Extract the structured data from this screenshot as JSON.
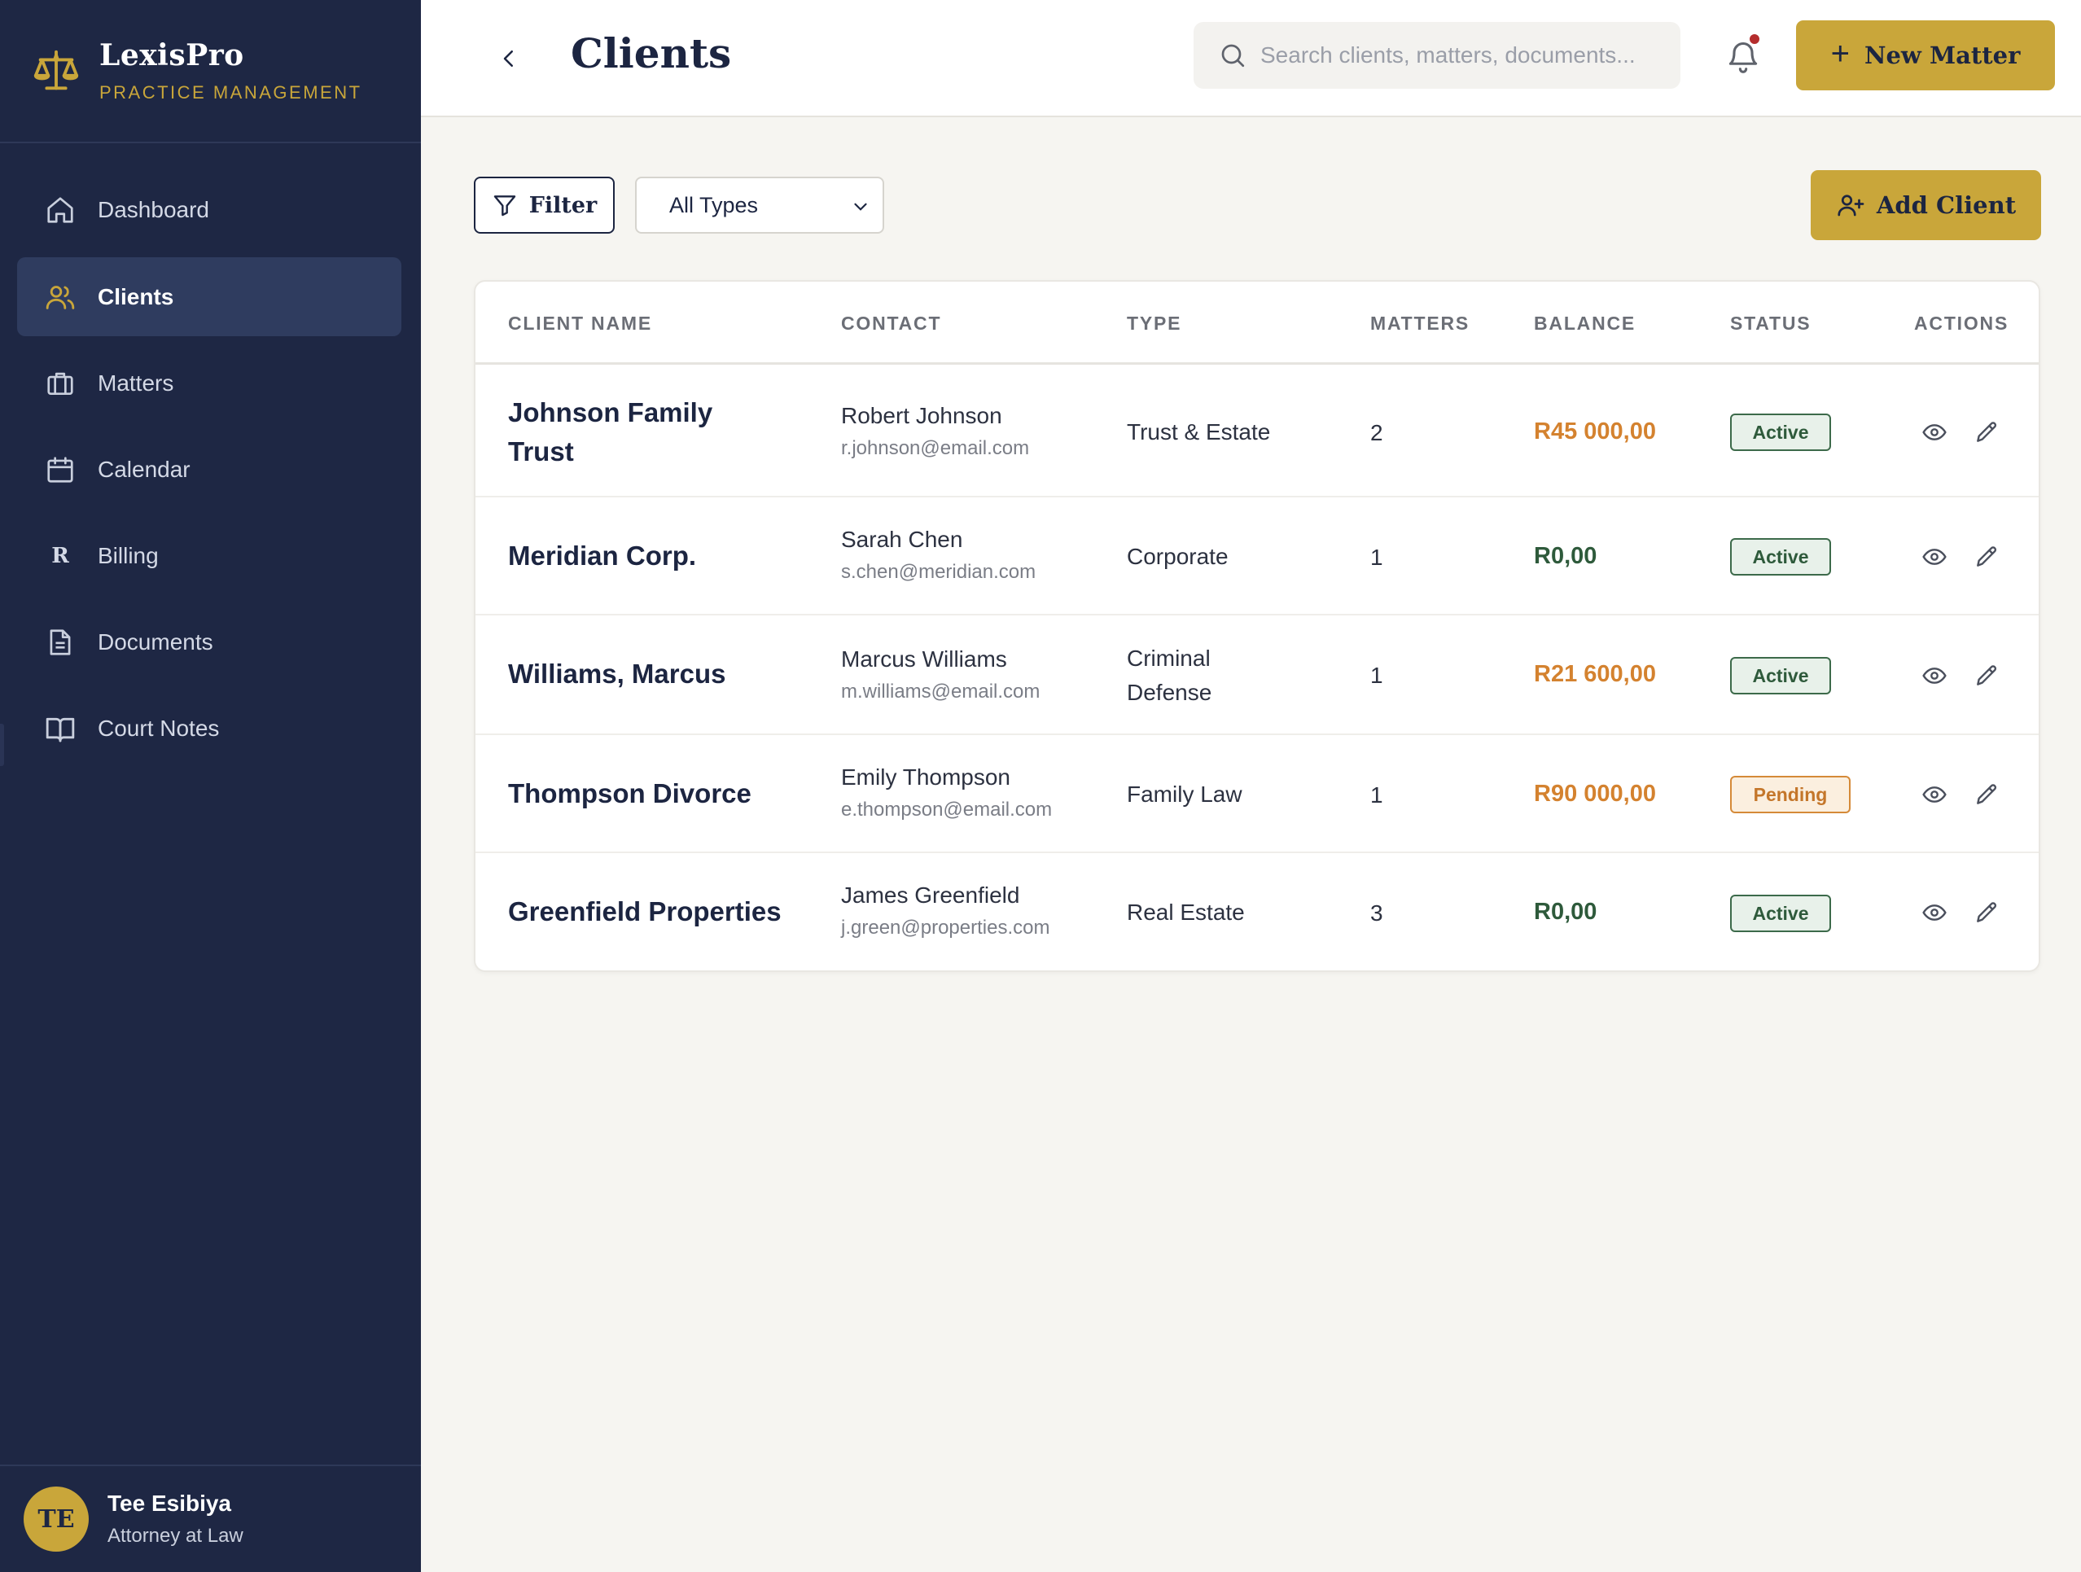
{
  "brand": {
    "name": "LexisPro",
    "subtitle": "PRACTICE MANAGEMENT"
  },
  "sidebar": {
    "items": [
      {
        "label": "Dashboard",
        "icon": "home-icon",
        "active": false
      },
      {
        "label": "Clients",
        "icon": "users-icon",
        "active": true
      },
      {
        "label": "Matters",
        "icon": "briefcase-icon",
        "active": false
      },
      {
        "label": "Calendar",
        "icon": "calendar-icon",
        "active": false
      },
      {
        "label": "Billing",
        "icon": "rand-icon",
        "active": false,
        "glyph": "R"
      },
      {
        "label": "Documents",
        "icon": "document-icon",
        "active": false
      },
      {
        "label": "Court Notes",
        "icon": "book-icon",
        "active": false
      }
    ]
  },
  "user": {
    "initials": "TE",
    "name": "Tee Esibiya",
    "role": "Attorney at Law"
  },
  "header": {
    "title": "Clients",
    "search_placeholder": "Search clients, matters, documents...",
    "new_matter_label": "New Matter",
    "new_matter_plus": "+"
  },
  "toolbar": {
    "filter_label": "Filter",
    "type_select": {
      "selected": "All Types"
    },
    "add_client_label": "Add Client"
  },
  "table": {
    "headers": {
      "client_name": "CLIENT NAME",
      "contact": "CONTACT",
      "type": "TYPE",
      "matters": "MATTERS",
      "balance": "BALANCE",
      "status": "STATUS",
      "actions": "ACTIONS"
    },
    "rows": [
      {
        "client": "Johnson Family Trust",
        "contact_name": "Robert Johnson",
        "contact_email": "r.johnson@email.com",
        "type": "Trust & Estate",
        "matters": "2",
        "balance": "R45 000,00",
        "status": "Active"
      },
      {
        "client": "Meridian Corp.",
        "contact_name": "Sarah Chen",
        "contact_email": "s.chen@meridian.com",
        "type": "Corporate",
        "matters": "1",
        "balance": "R0,00",
        "status": "Active"
      },
      {
        "client": "Williams, Marcus",
        "contact_name": "Marcus Williams",
        "contact_email": "m.williams@email.com",
        "type": "Criminal Defense",
        "matters": "1",
        "balance": "R21 600,00",
        "status": "Active"
      },
      {
        "client": "Thompson Divorce",
        "contact_name": "Emily Thompson",
        "contact_email": "e.thompson@email.com",
        "type": "Family Law",
        "matters": "1",
        "balance": "R90 000,00",
        "status": "Pending"
      },
      {
        "client": "Greenfield Properties",
        "contact_name": "James Greenfield",
        "contact_email": "j.green@properties.com",
        "type": "Real Estate",
        "matters": "3",
        "balance": "R0,00",
        "status": "Active"
      }
    ]
  },
  "colors": {
    "sidebar_bg": "#1e2744",
    "accent_gold": "#c9a63a",
    "balance_due": "#d4822f",
    "balance_zero": "#2e5a3b",
    "status_active": "#2e5a3b",
    "status_pending": "#c4762a",
    "notification_dot": "#b52d2d"
  }
}
